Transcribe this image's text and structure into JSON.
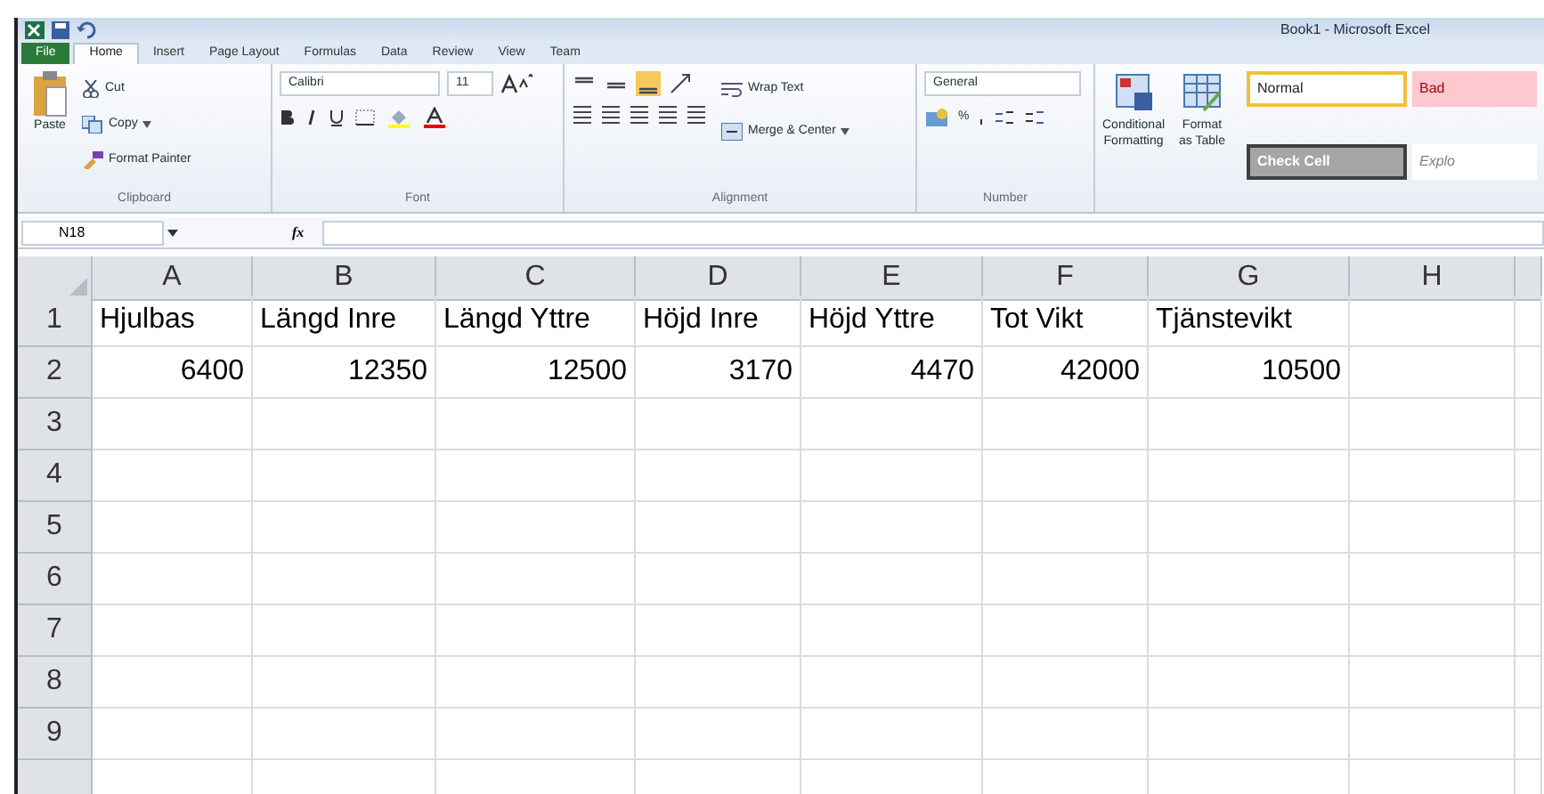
{
  "window": {
    "title": "Book1 - Microsoft Excel"
  },
  "tabs": [
    {
      "label": "File",
      "kind": "file",
      "selected": false
    },
    {
      "label": "Home",
      "kind": "tab",
      "selected": true
    },
    {
      "label": "Insert",
      "kind": "tab",
      "selected": false
    },
    {
      "label": "Page Layout",
      "kind": "tab",
      "selected": false
    },
    {
      "label": "Formulas",
      "kind": "tab",
      "selected": false
    },
    {
      "label": "Data",
      "kind": "tab",
      "selected": false
    },
    {
      "label": "Review",
      "kind": "tab",
      "selected": false
    },
    {
      "label": "View",
      "kind": "tab",
      "selected": false
    },
    {
      "label": "Team",
      "kind": "tab",
      "selected": false
    }
  ],
  "ribbon": {
    "clipboard": {
      "label": "Clipboard",
      "paste": "Paste",
      "cut": "Cut",
      "copy": "Copy",
      "format_painter": "Format Painter"
    },
    "font": {
      "label": "Font",
      "font_name": "Calibri",
      "font_size": "11"
    },
    "alignment": {
      "label": "Alignment",
      "wrap_text": "Wrap Text",
      "merge_center": "Merge & Center"
    },
    "number": {
      "label": "Number",
      "format": "General",
      "percent": "%"
    },
    "styles": {
      "conditional_formatting": [
        "Conditional",
        "Formatting"
      ],
      "format_as_table": [
        "Format",
        "as Table"
      ],
      "gallery": [
        {
          "label": "Normal",
          "kind": "normal",
          "selected": true
        },
        {
          "label": "Bad",
          "kind": "bad",
          "selected": false
        },
        {
          "label": "Check Cell",
          "kind": "check",
          "selected": false
        },
        {
          "label": "Explo",
          "kind": "explanatory",
          "selected": false
        }
      ]
    }
  },
  "formula_bar": {
    "name_box": "N18",
    "function_button": "fx"
  },
  "sheet": {
    "columns": [
      "A",
      "B",
      "C",
      "D",
      "E",
      "F",
      "G",
      "H"
    ],
    "rows": [
      {
        "header": "1",
        "cells": [
          {
            "text": "Hjulbas",
            "kind": "text"
          },
          {
            "text": "Längd Inre",
            "kind": "text"
          },
          {
            "text": "Längd Yttre",
            "kind": "text"
          },
          {
            "text": "Höjd Inre",
            "kind": "text"
          },
          {
            "text": "Höjd Yttre",
            "kind": "text"
          },
          {
            "text": "Tot Vikt",
            "kind": "text"
          },
          {
            "text": "Tjänstevikt",
            "kind": "text"
          }
        ]
      },
      {
        "header": "2",
        "cells": [
          {
            "text": "6400",
            "kind": "number"
          },
          {
            "text": "12350",
            "kind": "number"
          },
          {
            "text": "12500",
            "kind": "number"
          },
          {
            "text": "3170",
            "kind": "number"
          },
          {
            "text": "4470",
            "kind": "number"
          },
          {
            "text": "42000",
            "kind": "number"
          },
          {
            "text": "10500",
            "kind": "number"
          }
        ]
      },
      {
        "header": "3",
        "cells": []
      },
      {
        "header": "4",
        "cells": []
      },
      {
        "header": "5",
        "cells": []
      },
      {
        "header": "6",
        "cells": []
      },
      {
        "header": "7",
        "cells": []
      },
      {
        "header": "8",
        "cells": []
      },
      {
        "header": "9",
        "cells": []
      }
    ]
  }
}
